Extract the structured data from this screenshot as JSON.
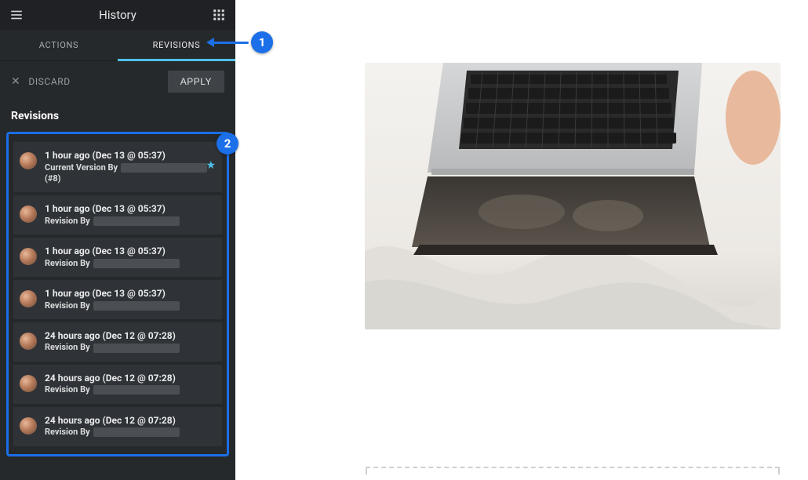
{
  "header": {
    "title": "History"
  },
  "tabs": {
    "actions": "ACTIONS",
    "revisions": "REVISIONS",
    "active": "revisions"
  },
  "controls": {
    "discard": "DISCARD",
    "apply": "APPLY"
  },
  "section": {
    "title": "Revisions"
  },
  "revisions": [
    {
      "time": "1 hour ago (Dec 13 @ 05:37)",
      "by_prefix": "Current Version By",
      "suffix": "(#8)",
      "starred": true
    },
    {
      "time": "1 hour ago (Dec 13 @ 05:37)",
      "by_prefix": "Revision By",
      "suffix": "",
      "starred": false
    },
    {
      "time": "1 hour ago (Dec 13 @ 05:37)",
      "by_prefix": "Revision By",
      "suffix": "",
      "starred": false
    },
    {
      "time": "1 hour ago (Dec 13 @ 05:37)",
      "by_prefix": "Revision By",
      "suffix": "",
      "starred": false
    },
    {
      "time": "24 hours ago (Dec 12 @ 07:28)",
      "by_prefix": "Revision By",
      "suffix": "",
      "starred": false
    },
    {
      "time": "24 hours ago (Dec 12 @ 07:28)",
      "by_prefix": "Revision By",
      "suffix": "",
      "starred": false
    },
    {
      "time": "24 hours ago (Dec 12 @ 07:28)",
      "by_prefix": "Revision By",
      "suffix": "",
      "starred": false
    }
  ],
  "callouts": {
    "one": "1",
    "two": "2"
  },
  "collapse_glyph": "‹"
}
